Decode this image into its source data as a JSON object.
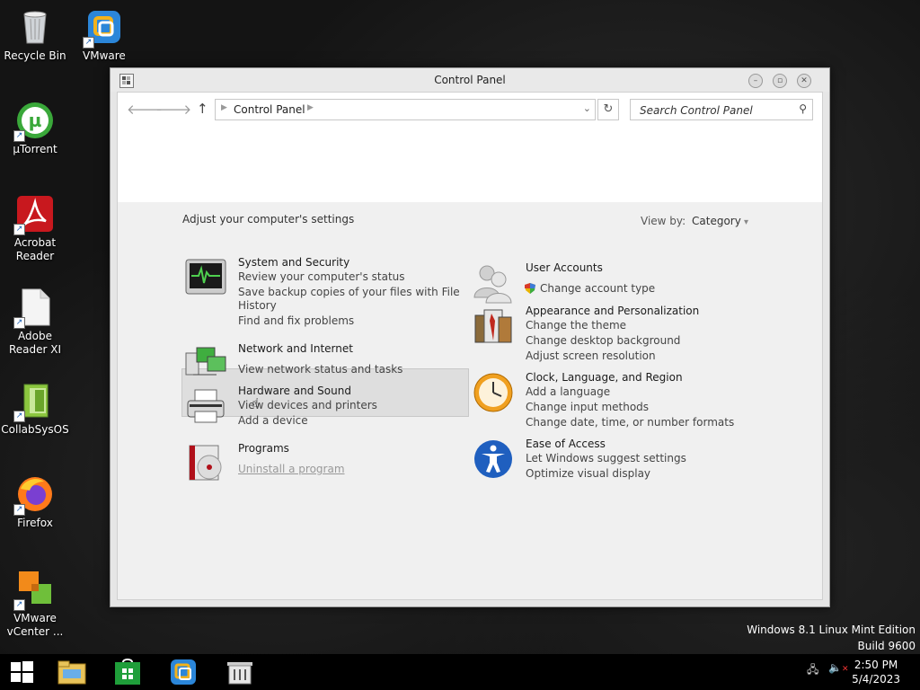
{
  "desktop": {
    "icons": [
      {
        "label": "Recycle Bin"
      },
      {
        "label": "VMware Workst..."
      },
      {
        "label": "µTorrent"
      },
      {
        "label": "Acrobat Reader"
      },
      {
        "label": "Adobe Reader XI"
      },
      {
        "label": "CollabSysOS"
      },
      {
        "label": "Firefox"
      },
      {
        "label": "VMware vCenter ..."
      }
    ],
    "watermark_line1": "Windows 8.1 Linux Mint Edition",
    "watermark_line2": "Build 9600"
  },
  "window": {
    "title": "Control Panel",
    "address": "Control Panel",
    "search_placeholder": "Search Control Panel",
    "header_text": "Adjust your computer's settings",
    "view_by_label": "View by:",
    "view_by_value": "Category",
    "categories": {
      "system": {
        "title": "System and Security",
        "links": [
          "Review your computer's status",
          "Save backup copies of your files with File",
          "History",
          "Find and fix problems"
        ]
      },
      "network": {
        "title": "Network and Internet",
        "links": [
          "View network status and tasks"
        ]
      },
      "hardware": {
        "title": "Hardware and Sound",
        "links": [
          "View devices and printers",
          "Add a device"
        ]
      },
      "programs": {
        "title": "Programs",
        "links": [
          "Uninstall a program"
        ]
      },
      "users": {
        "title": "User Accounts",
        "links": [
          "Change account type"
        ]
      },
      "appearance": {
        "title": "Appearance and Personalization",
        "links": [
          "Change the theme",
          "Change desktop background",
          "Adjust screen resolution"
        ]
      },
      "clock": {
        "title": "Clock, Language, and Region",
        "links": [
          "Add a language",
          "Change input methods",
          "Change date, time, or number formats"
        ]
      },
      "ease": {
        "title": "Ease of Access",
        "links": [
          "Let Windows suggest settings",
          "Optimize visual display"
        ]
      }
    }
  },
  "taskbar": {
    "time": "2:50 PM",
    "date": "5/4/2023"
  },
  "colors": {
    "accent": "#1a6fc9",
    "window_bg": "#f0f0f0"
  }
}
